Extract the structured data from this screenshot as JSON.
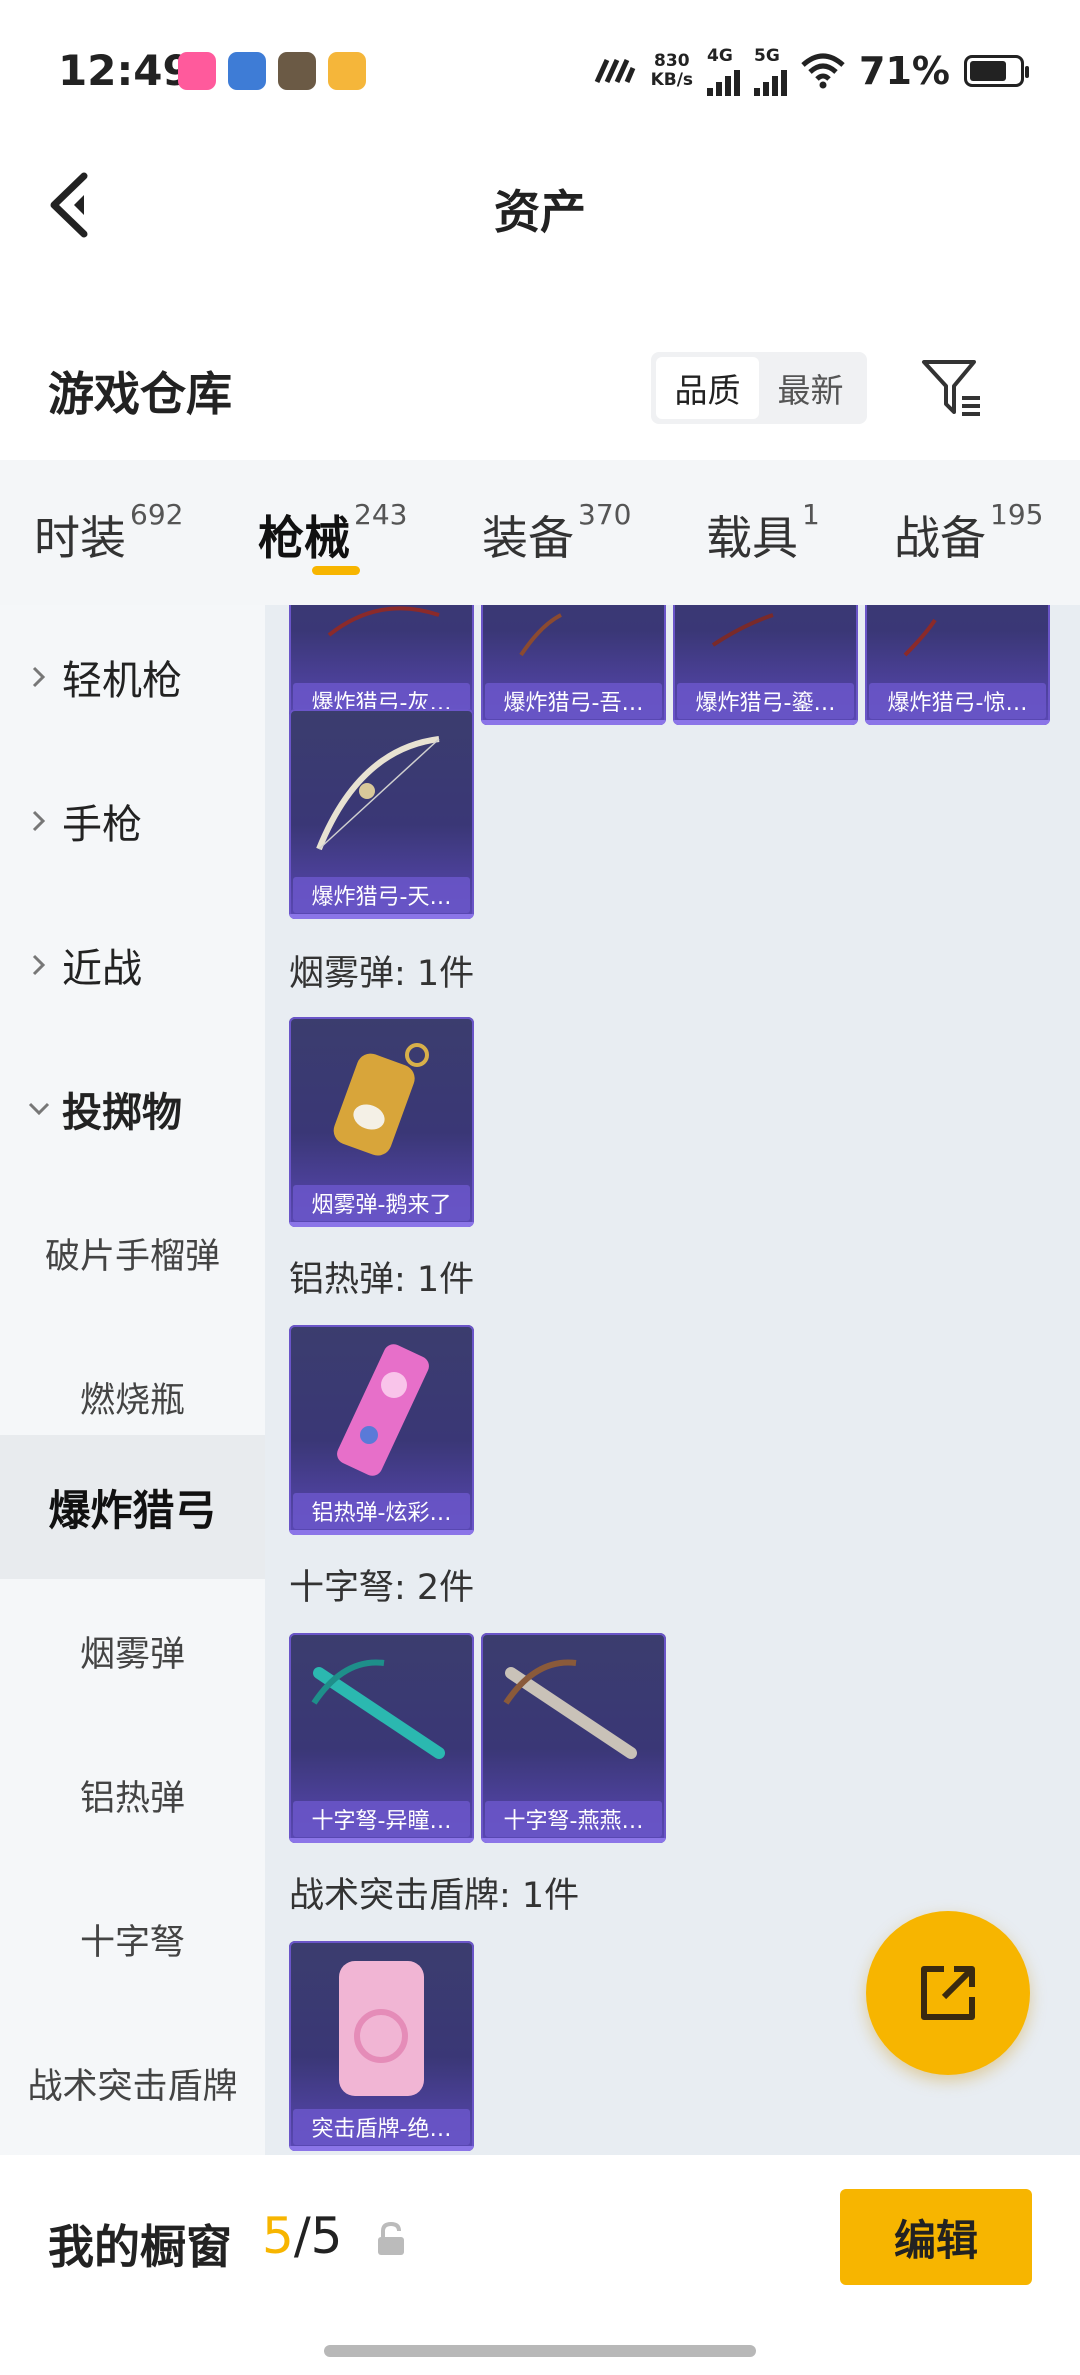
{
  "status_bar": {
    "time": "12:49",
    "speed_value": "830",
    "speed_unit": "KB/s",
    "net_1": "4G",
    "net_2": "5G",
    "battery": "71%"
  },
  "header": {
    "title": "资产"
  },
  "warehouse": {
    "title": "游戏仓库",
    "sort_options": [
      "品质",
      "最新"
    ],
    "sort_selected": "品质"
  },
  "tabs": [
    {
      "label": "时装",
      "count": "692",
      "active": false
    },
    {
      "label": "枪械",
      "count": "243",
      "active": true
    },
    {
      "label": "装备",
      "count": "370",
      "active": false
    },
    {
      "label": "载具",
      "count": "1",
      "active": false
    },
    {
      "label": "战备",
      "count": "195",
      "active": false
    }
  ],
  "sidebar": {
    "categories": [
      {
        "label": "轻机枪",
        "expanded": false
      },
      {
        "label": "手枪",
        "expanded": false
      },
      {
        "label": "近战",
        "expanded": false
      },
      {
        "label": "投掷物",
        "expanded": true
      }
    ],
    "subitems": [
      {
        "label": "破片手榴弹",
        "active": false
      },
      {
        "label": "燃烧瓶",
        "active": false
      },
      {
        "label": "爆炸猎弓",
        "active": true
      },
      {
        "label": "烟雾弹",
        "active": false
      },
      {
        "label": "铝热弹",
        "active": false
      },
      {
        "label": "十字弩",
        "active": false
      },
      {
        "label": "战术突击盾牌",
        "active": false
      }
    ]
  },
  "content": {
    "top_row": [
      "爆炸猎弓-灰…",
      "爆炸猎弓-吾…",
      "爆炸猎弓-鎏…",
      "爆炸猎弓-惊…"
    ],
    "bow_single": "爆炸猎弓-天…",
    "groups": [
      {
        "label": "烟雾弹: 1件",
        "items": [
          "烟雾弹-鹅来了"
        ]
      },
      {
        "label": "铝热弹: 1件",
        "items": [
          "铝热弹-炫彩…"
        ]
      },
      {
        "label": "十字弩: 2件",
        "items": [
          "十字弩-异瞳…",
          "十字弩-燕燕…"
        ]
      },
      {
        "label": "战术突击盾牌: 1件",
        "items": [
          "突击盾牌-绝…"
        ]
      }
    ]
  },
  "bottom_bar": {
    "label": "我的橱窗",
    "count_current": "5",
    "count_sep_total": "/5",
    "edit_label": "编辑"
  },
  "colors": {
    "accent": "#f7b500",
    "card_bg": "#3a3776",
    "caption": "#6955c8"
  }
}
